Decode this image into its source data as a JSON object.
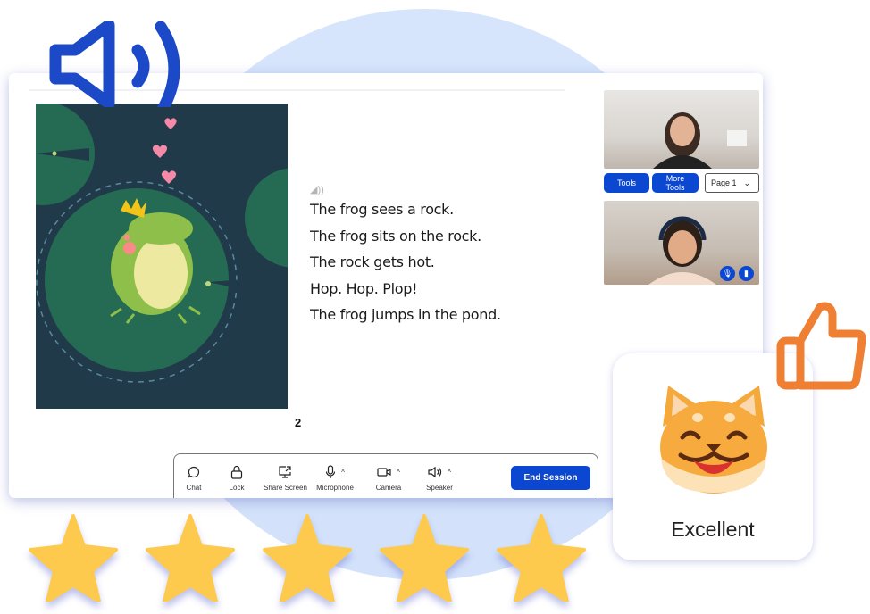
{
  "story": {
    "audio_icon": "speaker-small-icon",
    "lines": [
      "The frog sees a rock.",
      "The frog sits on the rock.",
      "The rock gets hot.",
      "Hop. Hop. Plop!",
      "The frog jumps in the pond."
    ],
    "page_number": "2"
  },
  "side_panel": {
    "tools_label": "Tools",
    "more_tools_label": "More Tools",
    "page_select_value": "Page 1"
  },
  "toolbar": {
    "chat_label": "Chat",
    "lock_label": "Lock",
    "share_screen_label": "Share Screen",
    "microphone_label": "Microphone",
    "camera_label": "Camera",
    "speaker_label": "Speaker",
    "end_session_label": "End Session"
  },
  "rating": {
    "label": "Excellent",
    "stars": 5,
    "max_stars": 5
  },
  "colors": {
    "brand_blue": "#0b47d1",
    "speaker_blue": "#1b49c8",
    "thumb_orange": "#ef7f32",
    "star_yellow": "#fdca4e"
  }
}
